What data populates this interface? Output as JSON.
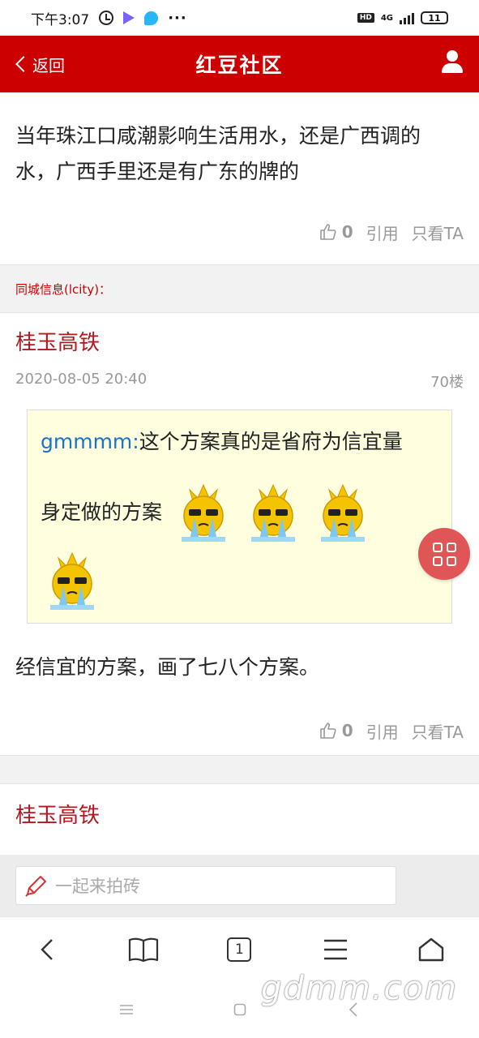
{
  "status_bar": {
    "time": "下午3:07",
    "more": "···",
    "hd": "HD",
    "network": "4G",
    "battery": "11"
  },
  "header": {
    "back_label": "返回",
    "title": "红豆社区"
  },
  "posts": [
    {
      "text_lines": [
        "当年珠江口咸潮影响生活用水，还是广西调的",
        "水，广西手里还是有广东的牌的"
      ],
      "likes": "0",
      "quote_label": "引用",
      "only_ta_label": "只看TA"
    },
    {
      "section_label": "同城信息(lcity)：",
      "author": "桂玉高铁",
      "date": "2020-08-05 20:40",
      "floor": "70楼",
      "quote": {
        "name": "gmmmm:",
        "line1": "这个方案真的是省府为信宜量",
        "line2": "身定做的方案"
      },
      "text": "经信宜的方案，画了七八个方案。",
      "likes": "0",
      "quote_label": "引用",
      "only_ta_label": "只看TA"
    },
    {
      "author": "桂玉高铁"
    }
  ],
  "comment_bar": {
    "placeholder": "一起来拍砖"
  },
  "browser_toolbar": {
    "tabs_count": "1"
  },
  "watermark": "gdmm.com",
  "colors": {
    "brand_red": "#cc0000",
    "author_red": "#b0171f",
    "quote_bg": "#ffffe0",
    "quote_name": "#1a73c8",
    "fab": "#e05555"
  }
}
